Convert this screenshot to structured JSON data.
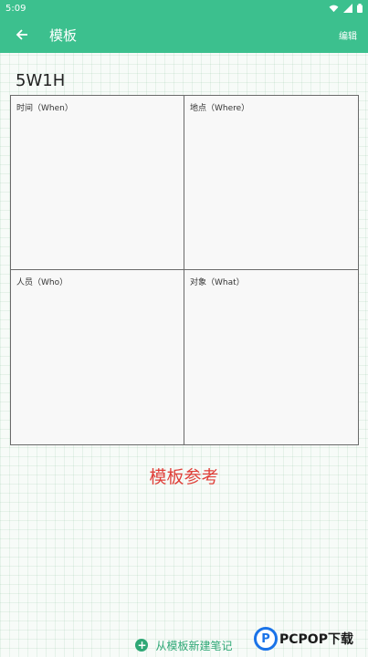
{
  "status_bar": {
    "time": "5:09"
  },
  "app_bar": {
    "title": "模板",
    "edit_label": "编辑"
  },
  "template": {
    "title": "5W1H",
    "cells": [
      {
        "label": "时间（When）"
      },
      {
        "label": "地点（Where）"
      },
      {
        "label": "人员（Who）"
      },
      {
        "label": "对象（What）"
      }
    ],
    "reference_label": "模板参考"
  },
  "bottom_bar": {
    "new_note_label": "从模板新建笔记"
  },
  "watermark": {
    "logo_letter": "P",
    "text": "PCPOP下载"
  },
  "colors": {
    "accent": "#3cc08e",
    "reference_red": "#e0403a",
    "action_green": "#2fa876"
  },
  "icons": [
    "wifi-icon",
    "signal-icon",
    "battery-icon",
    "back-arrow-icon",
    "plus-circle-icon"
  ]
}
